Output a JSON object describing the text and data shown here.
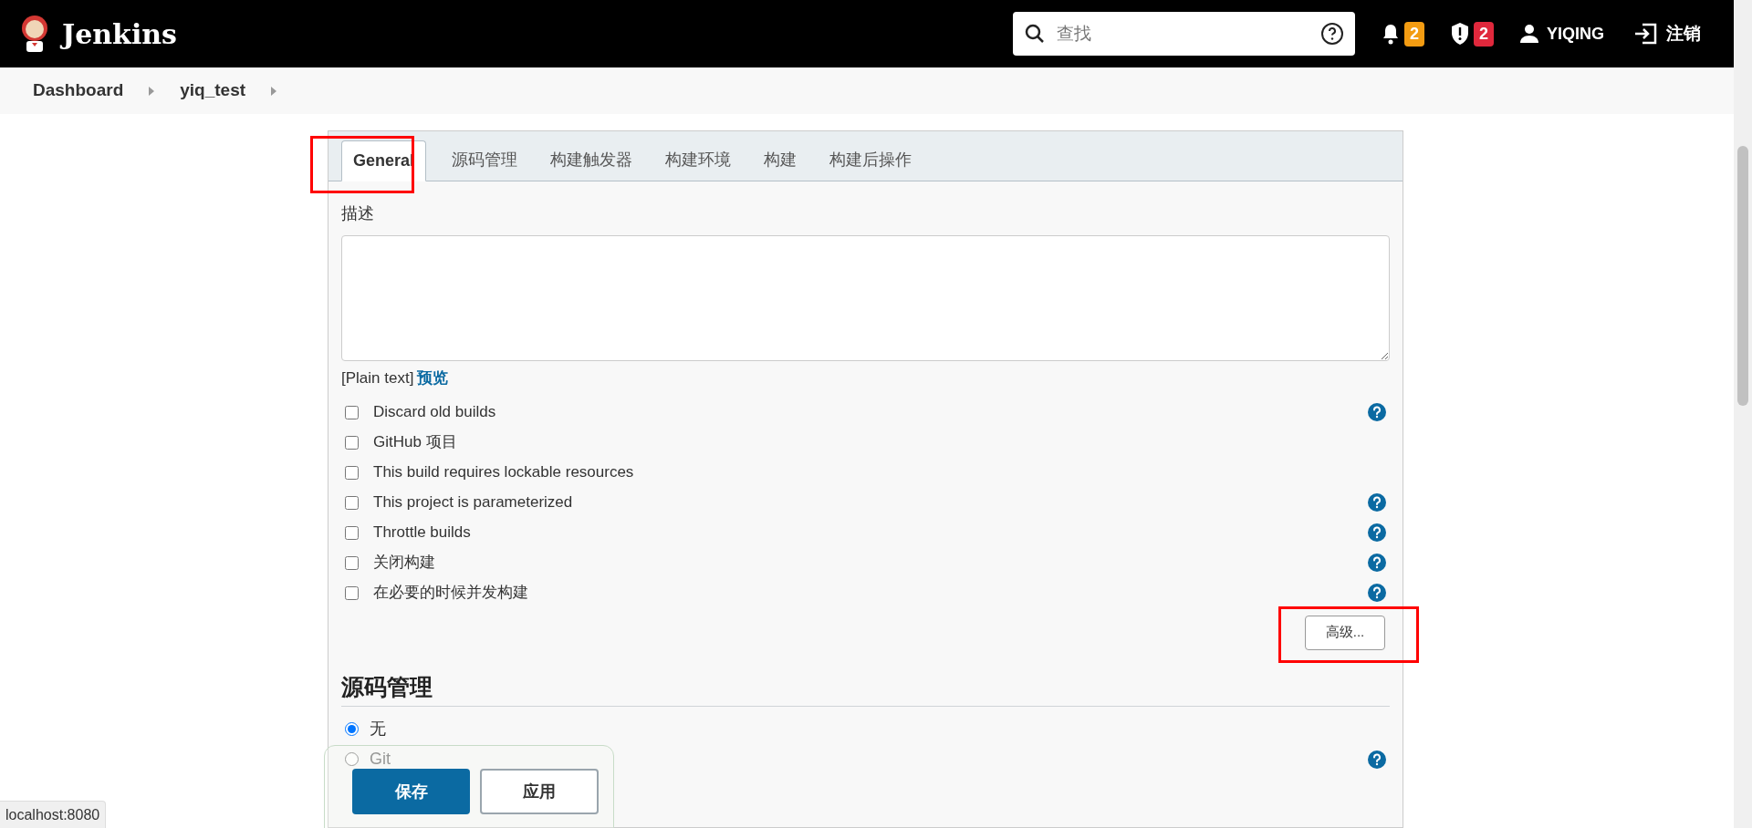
{
  "header": {
    "logo_text": "Jenkins",
    "search": {
      "placeholder": "查找"
    },
    "notifications": "2",
    "security": "2",
    "user": "YIQING",
    "logout": "注销"
  },
  "breadcrumb": [
    "Dashboard",
    "yiq_test"
  ],
  "tabs": [
    {
      "label": "General",
      "selected": true,
      "highlighted": true
    },
    {
      "label": "源码管理",
      "selected": false,
      "highlighted": false
    },
    {
      "label": "构建触发器",
      "selected": false,
      "highlighted": false
    },
    {
      "label": "构建环境",
      "selected": false,
      "highlighted": false
    },
    {
      "label": "构建",
      "selected": false,
      "highlighted": false
    },
    {
      "label": "构建后操作",
      "selected": false,
      "highlighted": false
    }
  ],
  "description": {
    "label": "描述",
    "format": "[Plain text]",
    "preview": "预览"
  },
  "options": [
    {
      "label": "Discard old builds",
      "checked": false,
      "help": true
    },
    {
      "label": "GitHub 项目",
      "checked": false,
      "help": false
    },
    {
      "label": "This build requires lockable resources",
      "checked": false,
      "help": false
    },
    {
      "label": "This project is parameterized",
      "checked": false,
      "help": true
    },
    {
      "label": "Throttle builds",
      "checked": false,
      "help": true
    },
    {
      "label": "关闭构建",
      "checked": false,
      "help": true
    },
    {
      "label": "在必要的时候并发构建",
      "checked": false,
      "help": true
    }
  ],
  "advanced_button": {
    "label": "高级...",
    "highlighted": true
  },
  "scm": {
    "title": "源码管理",
    "options": [
      {
        "label": "无",
        "selected": true,
        "help": false
      },
      {
        "label": "Git",
        "selected": false,
        "help": true
      }
    ]
  },
  "actions": {
    "save": "保存",
    "apply": "应用"
  },
  "status_url": "localhost:8080"
}
